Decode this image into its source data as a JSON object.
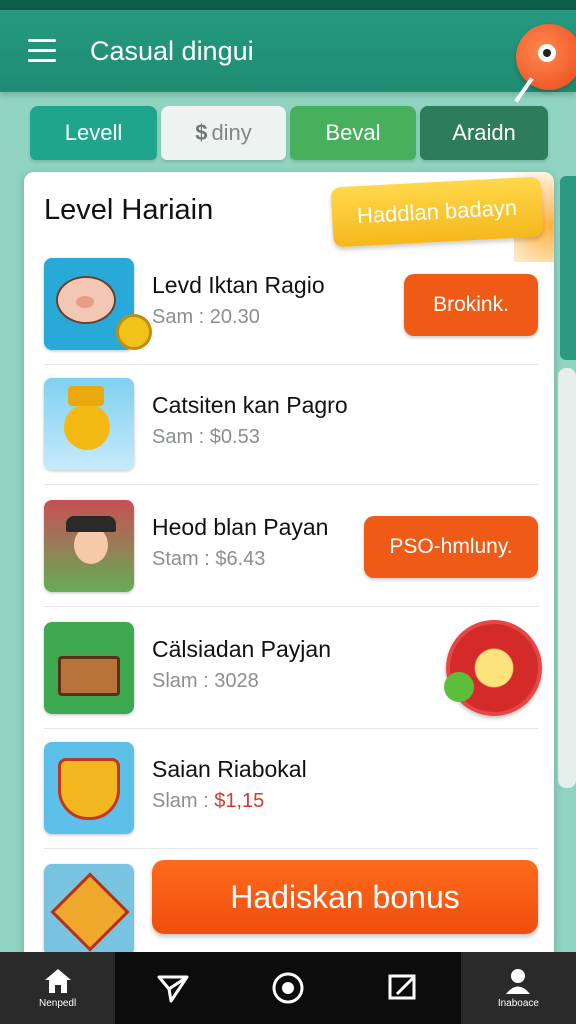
{
  "app": {
    "title": "Casual dingui"
  },
  "tabs": [
    {
      "label": "Levell",
      "color": "#1fa58c"
    },
    {
      "label": "diny",
      "symbol": "$",
      "color": "#eef2f1"
    },
    {
      "label": "Beval",
      "color": "#46b05c"
    },
    {
      "label": "Araidn",
      "color": "#2e7d5a"
    }
  ],
  "card": {
    "title": "Level Hariain",
    "highlight_button": "Haddlan badayn"
  },
  "rows": [
    {
      "name": "Levd Iktan Ragio",
      "sub": "Sam : 20.30",
      "action": "Brokink.",
      "icon": "piggy-bank-icon"
    },
    {
      "name": "Catsiten kan Pagro",
      "sub": "Sam : $0.53",
      "icon": "duck-hat-icon"
    },
    {
      "name": "Heod blan Payan",
      "sub": "Stam : $6.43",
      "action": "PSO-hmluny.",
      "icon": "cowboy-icon"
    },
    {
      "name": "Cälsiadan Payjan",
      "sub": "Slam : 3028",
      "icon": "treasure-chest-icon",
      "badge_icon": "lucky-seal-icon"
    },
    {
      "name": "Saian Riabokal",
      "sub_prefix": "Slam : ",
      "sub_value": "$1,15",
      "icon": "shield-badge-icon"
    },
    {
      "icon": "star-badge-icon"
    }
  ],
  "bonus_button": "Hadiskan bonus",
  "nav": [
    {
      "label": "Nenpedl",
      "icon": "home-icon"
    },
    {
      "label": "",
      "icon": "send-icon"
    },
    {
      "label": "",
      "icon": "circle-icon"
    },
    {
      "label": "",
      "icon": "edit-icon"
    },
    {
      "label": "Inaboace",
      "icon": "profile-icon"
    }
  ],
  "colors": {
    "primary": "#1f8c72",
    "action": "#f05a17",
    "highlight": "#ffd84a",
    "background": "#8fd3c0"
  }
}
